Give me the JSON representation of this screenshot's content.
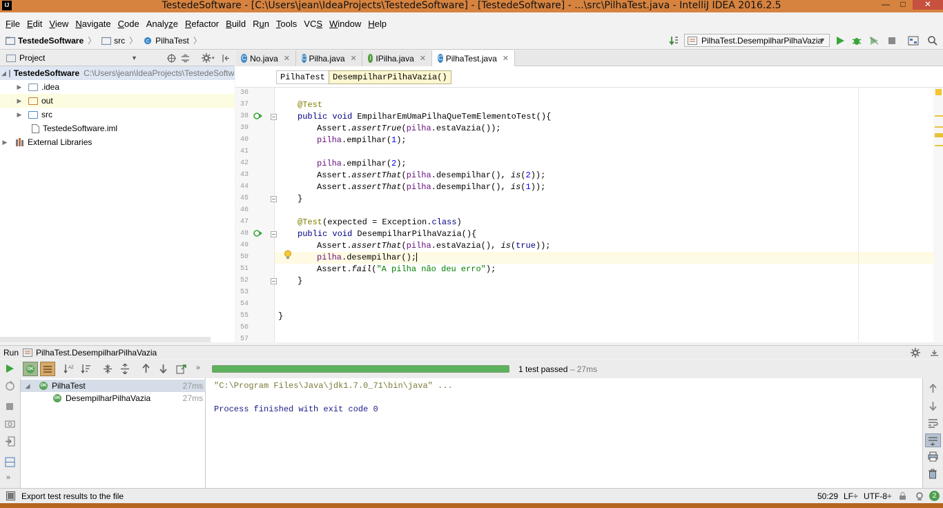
{
  "window": {
    "logo": "IJ",
    "title": "TestedeSoftware - [C:\\Users\\jean\\IdeaProjects\\TestedeSoftware] - [TestedeSoftware] - ...\\src\\PilhaTest.java - IntelliJ IDEA 2016.2.5",
    "minimize": "—",
    "maximize": "□",
    "close": "✕"
  },
  "menu": [
    {
      "key": "F",
      "rest": "ile"
    },
    {
      "key": "E",
      "rest": "dit"
    },
    {
      "key": "V",
      "rest": "iew"
    },
    {
      "key": "N",
      "rest": "avigate"
    },
    {
      "key": "C",
      "rest": "ode"
    },
    {
      "key": "",
      "rest": "Analy",
      "key2": "z",
      "rest2": "e"
    },
    {
      "key": "R",
      "rest": "efactor"
    },
    {
      "key": "B",
      "rest": "uild"
    },
    {
      "key": "",
      "rest": "R",
      "key2": "u",
      "rest2": "n"
    },
    {
      "key": "T",
      "rest": "ools"
    },
    {
      "key": "",
      "rest": "VC",
      "key2": "S",
      "rest2": ""
    },
    {
      "key": "W",
      "rest": "indow"
    },
    {
      "key": "H",
      "rest": "elp"
    }
  ],
  "breadcrumb": {
    "project": "TestedeSoftware",
    "folder": "src",
    "file": "PilhaTest"
  },
  "run_config": "PilhaTest.DesempilharPilhaVazia",
  "project_panel": {
    "title": "Project",
    "root_name": "TestedeSoftware",
    "root_path": "C:\\Users\\jean\\IdeaProjects\\TestedeSoftware",
    "items": [
      {
        "label": ".idea"
      },
      {
        "label": "out"
      },
      {
        "label": "src"
      },
      {
        "label": "TestedeSoftware.iml"
      },
      {
        "label": "External Libraries"
      }
    ]
  },
  "tabs": [
    {
      "label": "No.java",
      "icon": "C"
    },
    {
      "label": "Pilha.java",
      "icon": "C"
    },
    {
      "label": "IPilha.java",
      "icon": "I"
    },
    {
      "label": "PilhaTest.java",
      "icon": "C"
    }
  ],
  "editor_breadcrumb": [
    "PilhaTest",
    "DesempilharPilhaVazia()"
  ],
  "line_numbers": [
    "36",
    "37",
    "38",
    "39",
    "40",
    "41",
    "42",
    "43",
    "44",
    "45",
    "46",
    "47",
    "48",
    "49",
    "50",
    "51",
    "52",
    "53",
    "54",
    "55",
    "56",
    "57"
  ],
  "code": {
    "l37": "@Test",
    "l38a": "public void ",
    "l38b": "EmpilharEmUmaPilhaQueTemElementoTest(){",
    "l39a": "Assert.",
    "l39b": "assertTrue",
    "l39c": "(",
    "l39d": "pilha",
    "l39e": ".estaVazia());",
    "l40a": "pilha",
    "l40b": ".empilhar(",
    "l40c": "1",
    "l40d": ");",
    "l42a": "pilha",
    "l42b": ".empilhar(",
    "l42c": "2",
    "l42d": ");",
    "l43a": "Assert.",
    "l43b": "assertThat",
    "l43c": "(",
    "l43d": "pilha",
    "l43e": ".desempilhar(), ",
    "l43f": "is",
    "l43g": "(",
    "l43h": "2",
    "l43i": "));",
    "l44a": "Assert.",
    "l44b": "assertThat",
    "l44c": "(",
    "l44d": "pilha",
    "l44e": ".desempilhar(), ",
    "l44f": "is",
    "l44g": "(",
    "l44h": "1",
    "l44i": "));",
    "l45": "}",
    "l47a": "@Test",
    "l47b": "(expected = Exception.",
    "l47c": "class",
    "l47d": ")",
    "l48a": "public void ",
    "l48b": "DesempilharPilhaVazia(){",
    "l49a": "Assert.",
    "l49b": "assertThat",
    "l49c": "(",
    "l49d": "pilha",
    "l49e": ".estaVazia(), ",
    "l49f": "is",
    "l49g": "(",
    "l49h": "true",
    "l49i": "));",
    "l50a": "pilha",
    "l50b": ".desempilhar();",
    "l51a": "Assert.",
    "l51b": "fail",
    "l51c": "(",
    "l51d": "\"A pilha não deu erro\"",
    "l51e": ");",
    "l52": "}",
    "l55": "}"
  },
  "run_panel": {
    "label": "Run",
    "config": "PilhaTest.DesempilharPilhaVazia",
    "status": "1 test passed",
    "status_time": " – 27ms",
    "ok_badge": "OK",
    "progress_fraction": 1.0,
    "tree": [
      {
        "label": "PilhaTest",
        "time": "27ms"
      },
      {
        "label": "DesempilharPilhaVazia",
        "time": "27ms"
      }
    ],
    "console": [
      "\"C:\\Program Files\\Java\\jdk1.7.0_71\\bin\\java\" ...",
      "",
      "Process finished with exit code 0"
    ]
  },
  "status_bar": {
    "message": "Export test results to the file",
    "position": "50:29",
    "line_sep": "LF÷",
    "encoding": "UTF-8÷",
    "badge": "2"
  },
  "colors": {
    "titlebar": "#d6833f",
    "close": "#c7503f",
    "progress": "#5cb35c",
    "taskbar": "#b5651d"
  }
}
